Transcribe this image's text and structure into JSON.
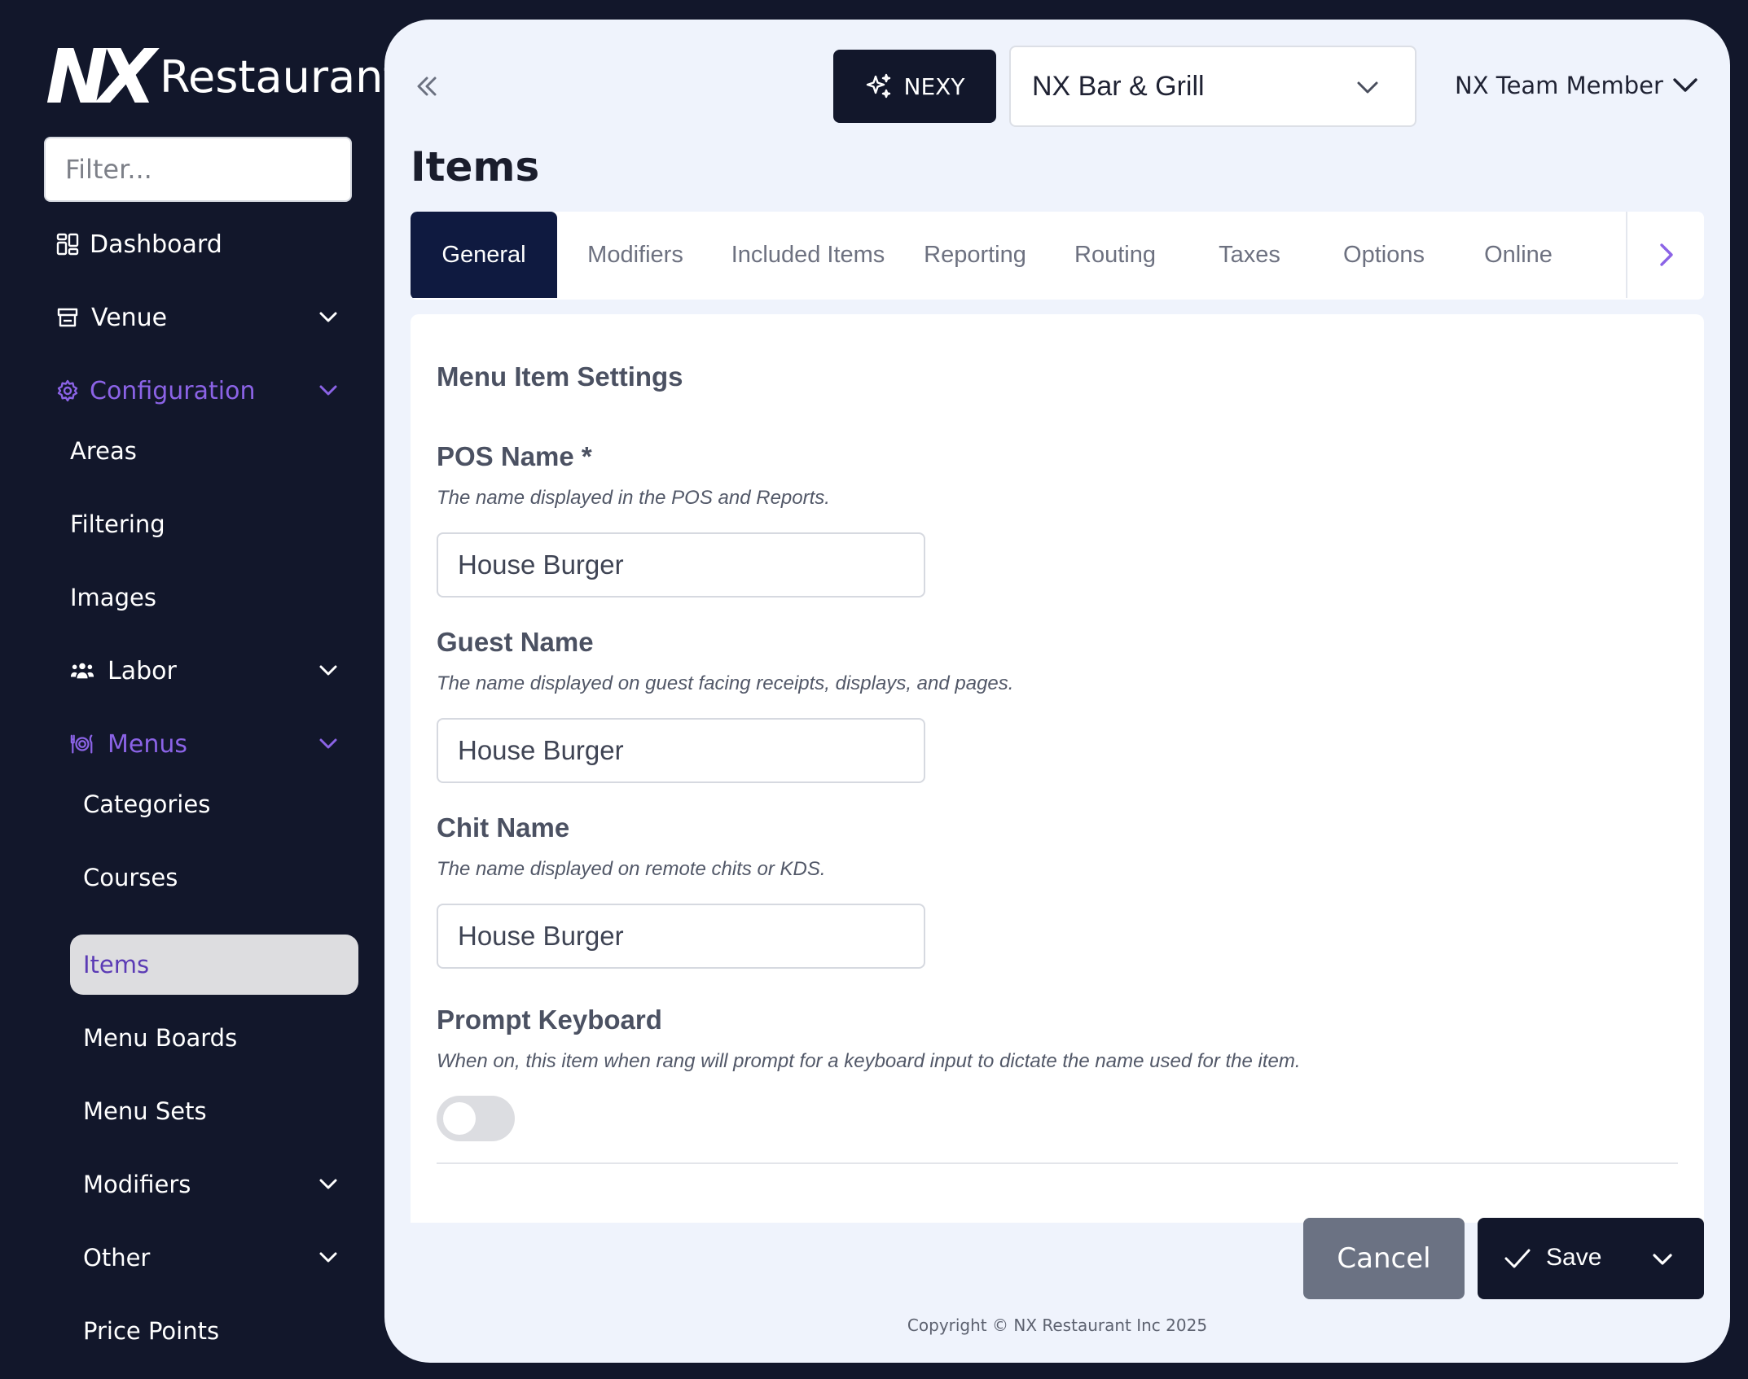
{
  "brand": {
    "mark": "NX",
    "name": "Restaurant"
  },
  "sidebar": {
    "filter_placeholder": "Filter...",
    "items": [
      {
        "label": "Dashboard"
      },
      {
        "label": "Venue"
      },
      {
        "label": "Configuration"
      },
      {
        "label": "Areas"
      },
      {
        "label": "Filtering"
      },
      {
        "label": "Images"
      },
      {
        "label": "Labor"
      },
      {
        "label": "Menus"
      },
      {
        "label": "Categories"
      },
      {
        "label": "Courses"
      },
      {
        "label": "Items"
      },
      {
        "label": "Menu Boards"
      },
      {
        "label": "Menu Sets"
      },
      {
        "label": "Modifiers"
      },
      {
        "label": "Other"
      },
      {
        "label": "Price Points"
      }
    ]
  },
  "header": {
    "nexy_label": "NEXY",
    "venue": "NX Bar & Grill",
    "user": "NX Team Member"
  },
  "page": {
    "title": "Items"
  },
  "tabs": [
    {
      "label": "General"
    },
    {
      "label": "Modifiers"
    },
    {
      "label": "Included Items"
    },
    {
      "label": "Reporting"
    },
    {
      "label": "Routing"
    },
    {
      "label": "Taxes"
    },
    {
      "label": "Options"
    },
    {
      "label": "Online"
    }
  ],
  "form": {
    "section_title": "Menu Item Settings",
    "pos_name": {
      "label": "POS Name *",
      "description": "The name displayed in the POS and Reports.",
      "value": "House Burger"
    },
    "guest_name": {
      "label": "Guest Name",
      "description": "The name displayed on guest facing receipts, displays, and pages.",
      "value": "House Burger"
    },
    "chit_name": {
      "label": "Chit Name",
      "description": "The name displayed on remote chits or KDS.",
      "value": "House Burger"
    },
    "prompt_keyboard": {
      "label": "Prompt Keyboard",
      "description": "When on, this item when rang will prompt for a keyboard input to dictate the name used for the item.",
      "enabled": false
    }
  },
  "actions": {
    "cancel": "Cancel",
    "save": "Save"
  },
  "footer": {
    "copyright": "Copyright © NX Restaurant Inc 2025"
  },
  "colors": {
    "accent": "#8b63e6",
    "sidebar_bg": "#12172b",
    "active_tab": "#0f1a40",
    "panel_bg": "#eff3fc"
  }
}
